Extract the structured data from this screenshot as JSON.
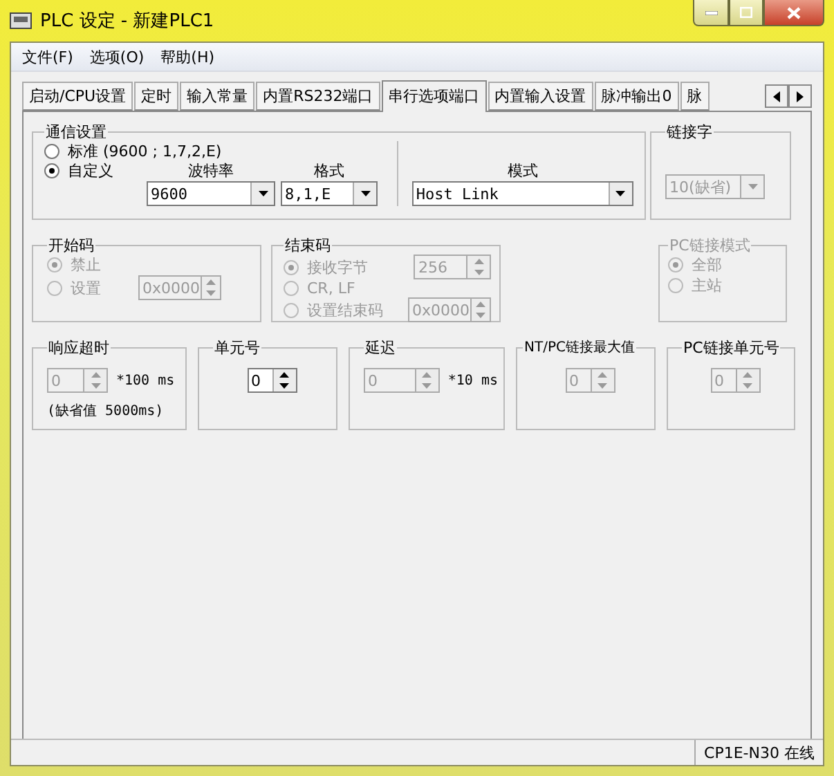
{
  "window": {
    "title": "PLC 设定 - 新建PLC1"
  },
  "menu": [
    {
      "label": "文件(F)"
    },
    {
      "label": "选项(O)"
    },
    {
      "label": "帮助(H)"
    }
  ],
  "tabs": [
    {
      "label": "启动/CPU设置",
      "selected": false
    },
    {
      "label": "定时",
      "selected": false
    },
    {
      "label": "输入常量",
      "selected": false
    },
    {
      "label": "内置RS232端口",
      "selected": false
    },
    {
      "label": "串行选项端口",
      "selected": true
    },
    {
      "label": "内置输入设置",
      "selected": false
    },
    {
      "label": "脉冲输出0",
      "selected": false
    },
    {
      "label": "脉",
      "selected": false
    }
  ],
  "comm_settings": {
    "title": "通信设置",
    "options": [
      {
        "label": "标准 (9600 ; 1,7,2,E)",
        "selected": false
      },
      {
        "label": "自定义",
        "selected": true
      }
    ],
    "baud": {
      "label": "波特率",
      "value": "9600"
    },
    "format": {
      "label": "格式",
      "value": "8,1,E"
    },
    "mode": {
      "label": "模式",
      "value": "Host Link"
    }
  },
  "link_word": {
    "title": "链接字",
    "value": "10(缺省)",
    "disabled": true
  },
  "start_code": {
    "title": "开始码",
    "disabled": true,
    "options": [
      {
        "label": "禁止",
        "selected": true
      },
      {
        "label": "设置",
        "selected": false,
        "value": "0x0000"
      }
    ]
  },
  "end_code": {
    "title": "结束码",
    "disabled": true,
    "options": [
      {
        "label": "接收字节",
        "selected": true,
        "value": "256"
      },
      {
        "label": "CR, LF",
        "selected": false
      },
      {
        "label": "设置结束码",
        "selected": false,
        "value": "0x0000"
      }
    ]
  },
  "pc_link_mode": {
    "title": "PC链接模式",
    "disabled": true,
    "options": [
      {
        "label": "全部",
        "selected": true
      },
      {
        "label": "主站",
        "selected": false
      }
    ]
  },
  "timing_groups": [
    {
      "title": "响应超时",
      "value": "0",
      "unit": "*100 ms",
      "note": "(缺省值 5000ms)",
      "disabled": true
    },
    {
      "title": "单元号",
      "value": "0",
      "disabled": false
    },
    {
      "title": "延迟",
      "value": "0",
      "unit": "*10 ms",
      "disabled": true
    },
    {
      "title": "NT/PC链接最大值",
      "value": "0",
      "disabled": true
    },
    {
      "title": "PC链接单元号",
      "value": "0",
      "disabled": true
    }
  ],
  "status_bar": {
    "text": "CP1E-N30 在线"
  }
}
